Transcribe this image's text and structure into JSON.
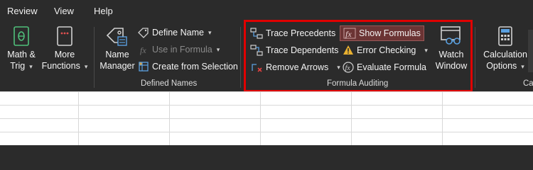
{
  "tabs": [
    "Review",
    "View",
    "Help"
  ],
  "ribbon": {
    "math_trig": {
      "line1": "Math &",
      "line2": "Trig"
    },
    "more_functions": {
      "line1": "More",
      "line2": "Functions"
    },
    "defined_names": {
      "name_manager": {
        "line1": "Name",
        "line2": "Manager"
      },
      "define_name": "Define Name",
      "use_in_formula": "Use in Formula",
      "create_from_selection": "Create from Selection",
      "group_label": "Defined Names"
    },
    "formula_auditing": {
      "trace_precedents": "Trace Precedents",
      "trace_dependents": "Trace Dependents",
      "remove_arrows": "Remove Arrows",
      "show_formulas": "Show Formulas",
      "error_checking": "Error Checking",
      "evaluate_formula": "Evaluate Formula",
      "watch_window": {
        "line1": "Watch",
        "line2": "Window"
      },
      "group_label": "Formula Auditing"
    },
    "calculation_options": {
      "line1": "Calculation",
      "line2": "Options"
    },
    "calc_group_label_partial": "Ca"
  },
  "colors": {
    "ribbon_bg": "#2b2b2b",
    "highlight_box": "#e00000",
    "active_toggle_bg": "#6b3434",
    "sheet_bg": "#ffffff",
    "gridline": "#d8d8d8"
  },
  "icons": [
    "math-trig-icon",
    "more-functions-icon",
    "name-manager-icon",
    "define-name-icon",
    "use-in-formula-icon",
    "create-from-selection-icon",
    "trace-precedents-icon",
    "trace-dependents-icon",
    "remove-arrows-icon",
    "show-formulas-icon",
    "error-checking-icon",
    "evaluate-formula-icon",
    "watch-window-icon",
    "calculation-options-icon"
  ]
}
